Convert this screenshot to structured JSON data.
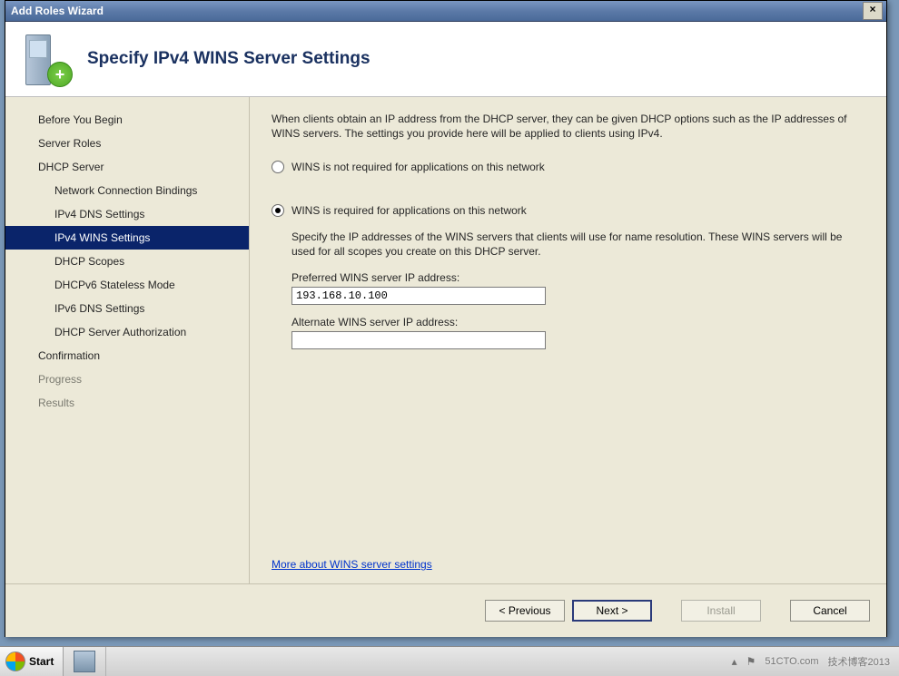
{
  "window": {
    "title": "Add Roles Wizard",
    "close_glyph": "×"
  },
  "header": {
    "page_title": "Specify IPv4 WINS Server Settings",
    "plus_glyph": "+"
  },
  "sidebar": {
    "items": [
      {
        "label": "Before You Begin",
        "child": false,
        "selected": false,
        "dim": false
      },
      {
        "label": "Server Roles",
        "child": false,
        "selected": false,
        "dim": false
      },
      {
        "label": "DHCP Server",
        "child": false,
        "selected": false,
        "dim": false
      },
      {
        "label": "Network Connection Bindings",
        "child": true,
        "selected": false,
        "dim": false
      },
      {
        "label": "IPv4 DNS Settings",
        "child": true,
        "selected": false,
        "dim": false
      },
      {
        "label": "IPv4 WINS Settings",
        "child": true,
        "selected": true,
        "dim": false
      },
      {
        "label": "DHCP Scopes",
        "child": true,
        "selected": false,
        "dim": false
      },
      {
        "label": "DHCPv6 Stateless Mode",
        "child": true,
        "selected": false,
        "dim": false
      },
      {
        "label": "IPv6 DNS Settings",
        "child": true,
        "selected": false,
        "dim": false
      },
      {
        "label": "DHCP Server Authorization",
        "child": true,
        "selected": false,
        "dim": false
      },
      {
        "label": "Confirmation",
        "child": false,
        "selected": false,
        "dim": false
      },
      {
        "label": "Progress",
        "child": false,
        "selected": false,
        "dim": true
      },
      {
        "label": "Results",
        "child": false,
        "selected": false,
        "dim": true
      }
    ]
  },
  "content": {
    "intro": "When clients obtain an IP address from the DHCP server, they can be given DHCP options such as the IP addresses of WINS servers. The settings you provide here will be applied to clients using IPv4.",
    "radio1_label": "WINS is not required for applications on this network",
    "radio2_label": "WINS is required for applications on this network",
    "radio_selected": 2,
    "radio2_desc": "Specify the IP addresses of the WINS servers that clients will use for name resolution. These WINS servers will be used for all scopes you create on this DHCP server.",
    "preferred_label": "Preferred WINS server IP address:",
    "preferred_value": "193.168.10.100",
    "alternate_label": "Alternate WINS server IP address:",
    "alternate_value": "",
    "more_link": "More about WINS server settings"
  },
  "footer": {
    "previous": "< Previous",
    "next": "Next >",
    "install": "Install",
    "cancel": "Cancel"
  },
  "taskbar": {
    "start": "Start",
    "watermark_site": "51CTO.com",
    "watermark_sub": "技术博客2013"
  },
  "tray": {
    "up_glyph": "▴",
    "flag_glyph": "⚑"
  }
}
